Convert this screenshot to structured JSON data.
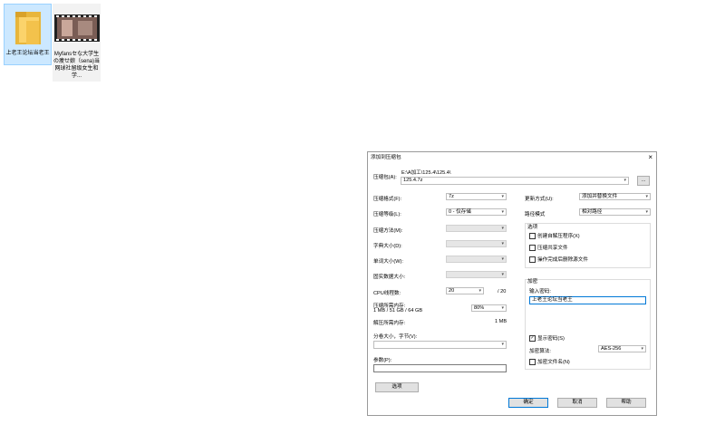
{
  "desktop": {
    "icons": [
      {
        "label": "上老王论坛当老王",
        "type": "folder"
      },
      {
        "label": "Myfansセな大学生の痩せ娘（sena)当网球社留级女生和学...",
        "type": "video"
      }
    ]
  },
  "dialog": {
    "title": "添加到压缩包",
    "close_icon": "×",
    "archive_label": "压缩包(A):",
    "archive_path": "E:\\A加工\\125.4\\125.4\\",
    "archive_name": "125.4.7z",
    "browse_label": "...",
    "left": {
      "format_label": "压缩格式(F):",
      "format_value": "7z",
      "level_label": "压缩等级(L):",
      "level_value": "0 - 仅存储",
      "method_label": "压缩方法(M):",
      "dict_label": "字典大小(D):",
      "word_label": "单词大小(W):",
      "solid_label": "固实数据大小:",
      "cpu_label": "CPU线程数:",
      "cpu_value": "20",
      "cpu_total": "/ 20",
      "mem_label": "压缩所需内存:",
      "mem_detail": "1 MB / 51 GB / 64 GB",
      "mem_value": "80%",
      "decomp_label": "解压所需内存:",
      "decomp_value": "1 MB",
      "split_label": "分卷大小，字节(V):",
      "params_label": "参数(P):",
      "options_button": "选项"
    },
    "right": {
      "update_label": "更新方式(U):",
      "update_value": "添加并替换文件",
      "path_label": "路径模式",
      "path_value": "相对路径",
      "options_group": "选项",
      "opt_sfx": "创建自解压程序(X)",
      "opt_shared": "压缩共享文件",
      "opt_delete": "操作完成后删除源文件",
      "encrypt_group": "加密",
      "password_label": "输入密码:",
      "password_value": "上老王论坛当老王",
      "show_password": "显示密码(S)",
      "method_label": "加密算法:",
      "method_value": "AES-256",
      "encrypt_names": "加密文件名(N)"
    },
    "buttons": {
      "ok": "确定",
      "cancel": "取消",
      "help": "帮助"
    }
  }
}
